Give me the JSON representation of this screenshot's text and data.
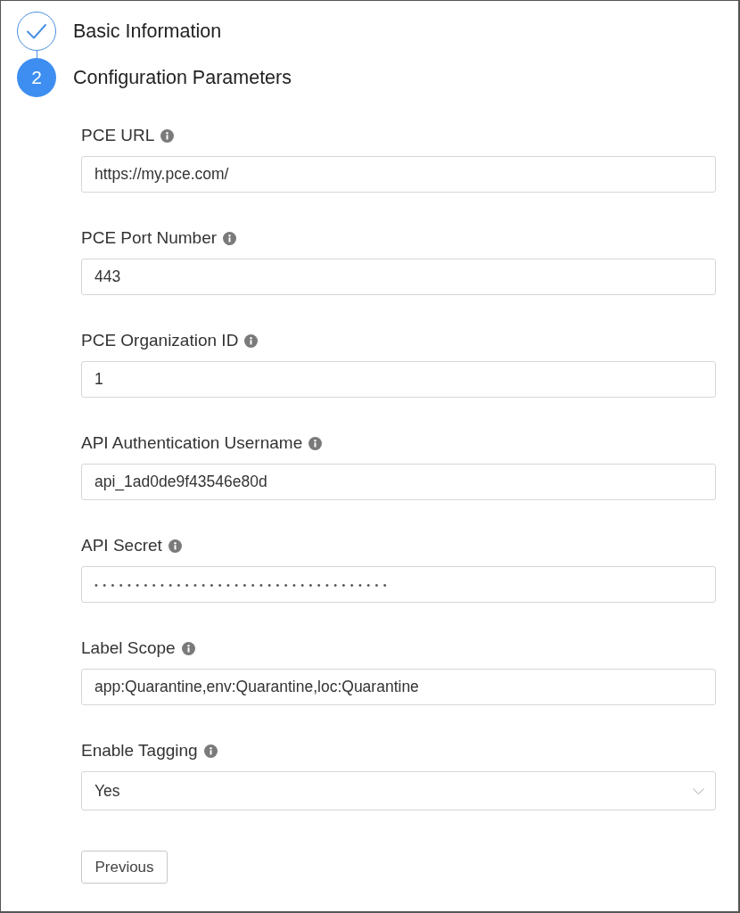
{
  "steps": [
    {
      "title": "Basic Information",
      "completed": true
    },
    {
      "title": "Configuration Parameters",
      "completed": false,
      "number": "2"
    }
  ],
  "fields": [
    {
      "label": "PCE URL",
      "kind": "text",
      "value": "https://my.pce.com/"
    },
    {
      "label": "PCE Port Number",
      "kind": "text",
      "value": "443"
    },
    {
      "label": "PCE Organization ID",
      "kind": "text",
      "value": "1"
    },
    {
      "label": "API Authentication Username",
      "kind": "text",
      "value": "api_1ad0de9f43546e80d"
    },
    {
      "label": "API Secret",
      "kind": "password",
      "value": "••••••••••••••••••••••••••••••••••••"
    },
    {
      "label": "Label Scope",
      "kind": "text",
      "value": "app:Quarantine,env:Quarantine,loc:Quarantine"
    },
    {
      "label": "Enable Tagging",
      "kind": "select",
      "value": "Yes"
    }
  ],
  "previous_button": {
    "label": "Previous"
  }
}
